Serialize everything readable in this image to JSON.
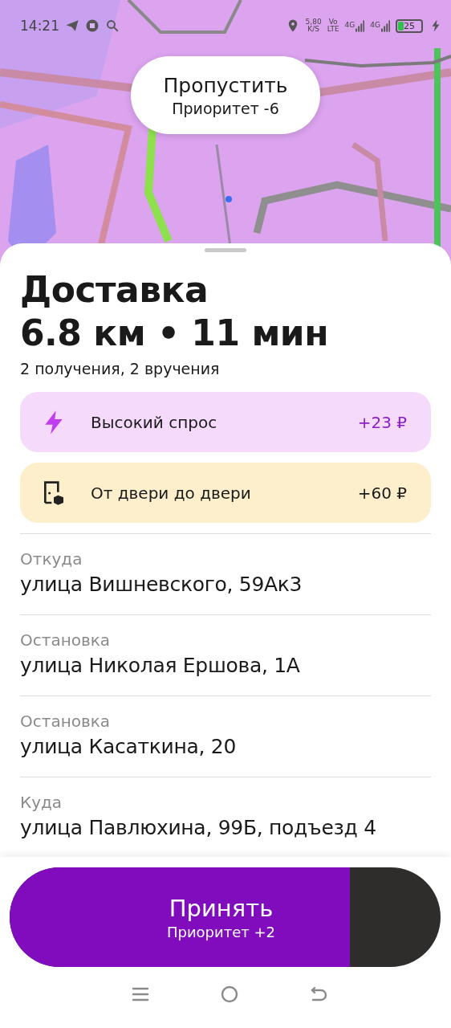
{
  "status_bar": {
    "time": "14:21",
    "speed": "5,80",
    "speed_unit": "K/S",
    "volte_top": "Vo",
    "volte_bottom": "LTE",
    "network_1": "4G",
    "network_2": "4G",
    "battery": "25"
  },
  "skip_button": {
    "label": "Пропустить",
    "sublabel": "Приоритет -6"
  },
  "order": {
    "title": "Доставка",
    "summary": "6.8 км • 11 мин",
    "details": "2 получения, 2 вручения"
  },
  "bonuses": [
    {
      "kind": "surge",
      "label": "Высокий спрос",
      "amount": "+23 ₽"
    },
    {
      "kind": "door",
      "label": "От двери до двери",
      "amount": "+60 ₽"
    }
  ],
  "route": [
    {
      "label": "Откуда",
      "address": "улица Вишневского, 59Ак3"
    },
    {
      "label": "Остановка",
      "address": "улица Николая Ершова, 1А"
    },
    {
      "label": "Остановка",
      "address": "улица Касаткина, 20"
    },
    {
      "label": "Куда",
      "address": "улица Павлюхина, 99Б, подъезд 4"
    }
  ],
  "accept_button": {
    "label": "Принять",
    "sublabel": "Приоритет +2",
    "level": 0.79
  }
}
